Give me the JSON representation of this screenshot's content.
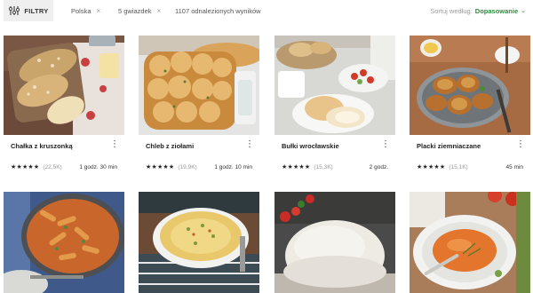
{
  "toolbar": {
    "filter_label": "FILTRY",
    "chips": [
      {
        "label": "Polska",
        "remove": "×"
      },
      {
        "label": "5 gwiazdek",
        "remove": "×"
      }
    ],
    "results_text": "1107 odnalezionych wyników",
    "sort_label": "Sortuj według:",
    "sort_value": "Dopasowanie",
    "sort_caret": "⌄"
  },
  "recipes": [
    {
      "title": "Chałka z kruszonką",
      "stars": "★★★★★",
      "count": "(22,5K)",
      "time": "1 godz. 30 min"
    },
    {
      "title": "Chleb z ziołami",
      "stars": "★★★★★",
      "count": "(19,9K)",
      "time": "1 godz. 10 min"
    },
    {
      "title": "Bułki wrocławskie",
      "stars": "★★★★★",
      "count": "(15,3K)",
      "time": "2 godz."
    },
    {
      "title": "Placki ziemniaczane",
      "stars": "★★★★★",
      "count": "(15,1K)",
      "time": "45 min"
    }
  ],
  "card_menu_glyph": "⋮",
  "colors": {
    "accent": "#2e8b3e",
    "chip_bg": "#efefef"
  }
}
